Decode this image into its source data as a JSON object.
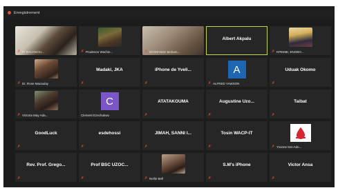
{
  "window": {
    "title": "Enregistrement",
    "colors": {
      "background": "#1c1c1c",
      "tile": "#262626",
      "active_border": "#c8d84a",
      "mic_muted": "#e0533a"
    }
  },
  "tiles": [
    {
      "kind": "photo",
      "caption": "Pr BALOGOU...",
      "muted": true
    },
    {
      "kind": "photo",
      "caption": "Prudence Wachin...",
      "muted": true
    },
    {
      "kind": "photo",
      "caption": "DIOMANDE Moham...",
      "muted": true
    },
    {
      "kind": "name",
      "name": "Albert Akpalu",
      "caption": "",
      "muted": false,
      "active": true
    },
    {
      "kind": "photo",
      "caption": "KPEMIE, ENOBO...",
      "muted": true
    },
    {
      "kind": "photo",
      "caption": "Dr. Rose Macaulay",
      "muted": true
    },
    {
      "kind": "name",
      "name": "Madaki, JKA",
      "caption": "",
      "muted": true
    },
    {
      "kind": "name",
      "name": "iPhone de Yveli...",
      "caption": "",
      "muted": true
    },
    {
      "kind": "avatar",
      "letter": "A",
      "avatar_color": "#1e66b4",
      "caption": "ALFRED YAWSON",
      "muted": true
    },
    {
      "kind": "name",
      "name": "Uduak Okomo",
      "caption": "",
      "muted": true
    },
    {
      "kind": "photo",
      "caption": "Victoria May Ada...",
      "muted": true
    },
    {
      "kind": "avatar",
      "letter": "C",
      "avatar_color": "#7b57c5",
      "caption": "Clement Ezechukwu",
      "muted": false
    },
    {
      "kind": "name",
      "name": "ATATAKOUMA",
      "caption": "",
      "muted": true
    },
    {
      "kind": "name",
      "name": "Augustine Uzo...",
      "caption": "",
      "muted": true
    },
    {
      "kind": "name",
      "name": "Taibat",
      "caption": "",
      "muted": true
    },
    {
      "kind": "name",
      "name": "GoodLuck",
      "caption": "",
      "muted": true
    },
    {
      "kind": "name",
      "name": "esdehossi",
      "caption": "",
      "muted": true
    },
    {
      "kind": "name",
      "name": "JIMAH, SANNI I...",
      "caption": "",
      "muted": true
    },
    {
      "kind": "name",
      "name": "Tosin WACP-IT",
      "caption": "",
      "muted": true
    },
    {
      "kind": "logo",
      "caption": "Yvonne Dei-Ado...",
      "muted": true
    },
    {
      "kind": "name",
      "name": "Rev. Prof. Grego...",
      "caption": "",
      "muted": true
    },
    {
      "kind": "name",
      "name": "Prof BSC UZOC...",
      "caption": "",
      "muted": true
    },
    {
      "kind": "photo",
      "caption": "Nellie Bell",
      "muted": true
    },
    {
      "kind": "name",
      "name": "S.M's iPhone",
      "caption": "",
      "muted": true
    },
    {
      "kind": "name",
      "name": "Victor Ansa",
      "caption": "",
      "muted": true
    }
  ]
}
